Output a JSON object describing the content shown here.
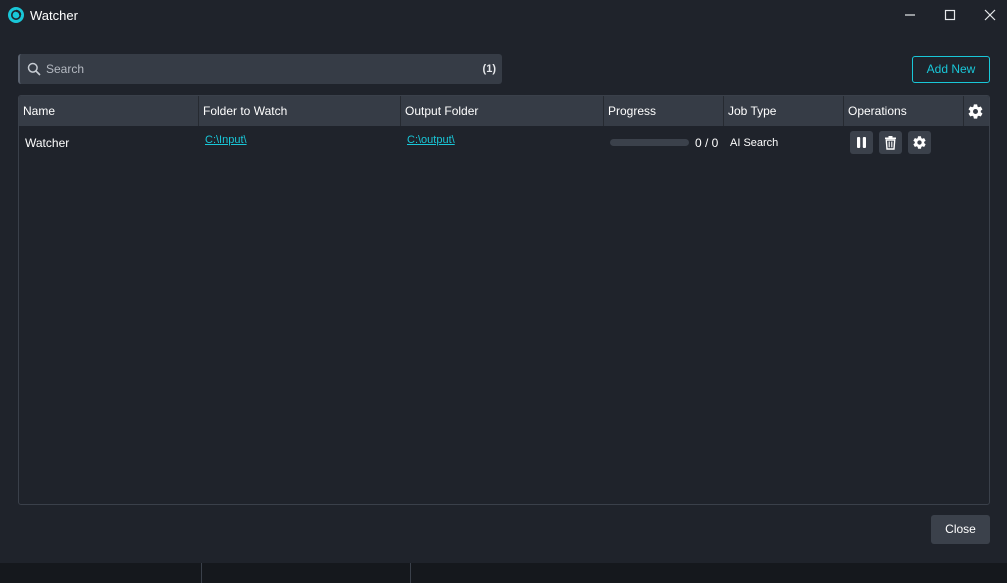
{
  "window": {
    "title": "Watcher"
  },
  "search": {
    "placeholder": "Search",
    "value": "",
    "count": "(1)"
  },
  "toolbar": {
    "add_new_label": "Add New"
  },
  "table": {
    "columns": [
      "Name",
      "Folder to Watch",
      "Output Folder",
      "Progress",
      "Job Type",
      "Operations"
    ],
    "rows": [
      {
        "name": "Watcher",
        "folder_to_watch": "C:\\Input\\",
        "output_folder": "C:\\output\\",
        "progress_text": "0 / 0",
        "progress_fraction": 0,
        "job_type": "AI Search"
      }
    ]
  },
  "footer": {
    "close_label": "Close"
  },
  "colors": {
    "accent": "#19c7d8",
    "background": "#1f232b",
    "header": "#363c46",
    "button": "#3b414b"
  },
  "icons": {
    "app": "watcher-logo-icon",
    "search": "search-icon",
    "settings": "gear-icon",
    "pause": "pause-icon",
    "delete": "trash-icon"
  }
}
